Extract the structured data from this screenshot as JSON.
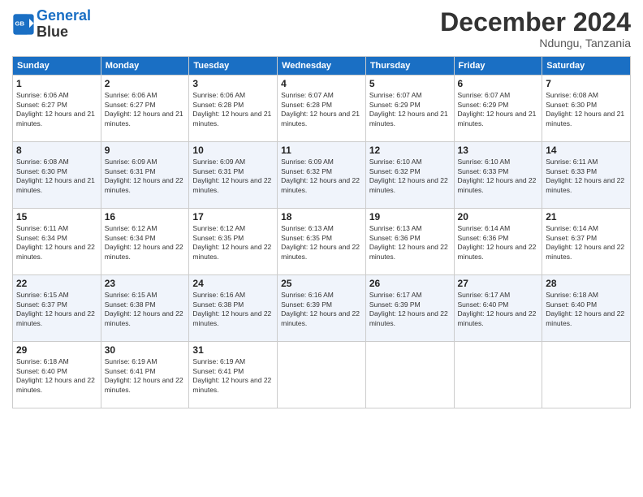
{
  "logo": {
    "line1": "General",
    "line2": "Blue"
  },
  "title": "December 2024",
  "location": "Ndungu, Tanzania",
  "days_of_week": [
    "Sunday",
    "Monday",
    "Tuesday",
    "Wednesday",
    "Thursday",
    "Friday",
    "Saturday"
  ],
  "weeks": [
    [
      {
        "day": "1",
        "sunrise": "Sunrise: 6:06 AM",
        "sunset": "Sunset: 6:27 PM",
        "daylight": "Daylight: 12 hours and 21 minutes."
      },
      {
        "day": "2",
        "sunrise": "Sunrise: 6:06 AM",
        "sunset": "Sunset: 6:27 PM",
        "daylight": "Daylight: 12 hours and 21 minutes."
      },
      {
        "day": "3",
        "sunrise": "Sunrise: 6:06 AM",
        "sunset": "Sunset: 6:28 PM",
        "daylight": "Daylight: 12 hours and 21 minutes."
      },
      {
        "day": "4",
        "sunrise": "Sunrise: 6:07 AM",
        "sunset": "Sunset: 6:28 PM",
        "daylight": "Daylight: 12 hours and 21 minutes."
      },
      {
        "day": "5",
        "sunrise": "Sunrise: 6:07 AM",
        "sunset": "Sunset: 6:29 PM",
        "daylight": "Daylight: 12 hours and 21 minutes."
      },
      {
        "day": "6",
        "sunrise": "Sunrise: 6:07 AM",
        "sunset": "Sunset: 6:29 PM",
        "daylight": "Daylight: 12 hours and 21 minutes."
      },
      {
        "day": "7",
        "sunrise": "Sunrise: 6:08 AM",
        "sunset": "Sunset: 6:30 PM",
        "daylight": "Daylight: 12 hours and 21 minutes."
      }
    ],
    [
      {
        "day": "8",
        "sunrise": "Sunrise: 6:08 AM",
        "sunset": "Sunset: 6:30 PM",
        "daylight": "Daylight: 12 hours and 21 minutes."
      },
      {
        "day": "9",
        "sunrise": "Sunrise: 6:09 AM",
        "sunset": "Sunset: 6:31 PM",
        "daylight": "Daylight: 12 hours and 22 minutes."
      },
      {
        "day": "10",
        "sunrise": "Sunrise: 6:09 AM",
        "sunset": "Sunset: 6:31 PM",
        "daylight": "Daylight: 12 hours and 22 minutes."
      },
      {
        "day": "11",
        "sunrise": "Sunrise: 6:09 AM",
        "sunset": "Sunset: 6:32 PM",
        "daylight": "Daylight: 12 hours and 22 minutes."
      },
      {
        "day": "12",
        "sunrise": "Sunrise: 6:10 AM",
        "sunset": "Sunset: 6:32 PM",
        "daylight": "Daylight: 12 hours and 22 minutes."
      },
      {
        "day": "13",
        "sunrise": "Sunrise: 6:10 AM",
        "sunset": "Sunset: 6:33 PM",
        "daylight": "Daylight: 12 hours and 22 minutes."
      },
      {
        "day": "14",
        "sunrise": "Sunrise: 6:11 AM",
        "sunset": "Sunset: 6:33 PM",
        "daylight": "Daylight: 12 hours and 22 minutes."
      }
    ],
    [
      {
        "day": "15",
        "sunrise": "Sunrise: 6:11 AM",
        "sunset": "Sunset: 6:34 PM",
        "daylight": "Daylight: 12 hours and 22 minutes."
      },
      {
        "day": "16",
        "sunrise": "Sunrise: 6:12 AM",
        "sunset": "Sunset: 6:34 PM",
        "daylight": "Daylight: 12 hours and 22 minutes."
      },
      {
        "day": "17",
        "sunrise": "Sunrise: 6:12 AM",
        "sunset": "Sunset: 6:35 PM",
        "daylight": "Daylight: 12 hours and 22 minutes."
      },
      {
        "day": "18",
        "sunrise": "Sunrise: 6:13 AM",
        "sunset": "Sunset: 6:35 PM",
        "daylight": "Daylight: 12 hours and 22 minutes."
      },
      {
        "day": "19",
        "sunrise": "Sunrise: 6:13 AM",
        "sunset": "Sunset: 6:36 PM",
        "daylight": "Daylight: 12 hours and 22 minutes."
      },
      {
        "day": "20",
        "sunrise": "Sunrise: 6:14 AM",
        "sunset": "Sunset: 6:36 PM",
        "daylight": "Daylight: 12 hours and 22 minutes."
      },
      {
        "day": "21",
        "sunrise": "Sunrise: 6:14 AM",
        "sunset": "Sunset: 6:37 PM",
        "daylight": "Daylight: 12 hours and 22 minutes."
      }
    ],
    [
      {
        "day": "22",
        "sunrise": "Sunrise: 6:15 AM",
        "sunset": "Sunset: 6:37 PM",
        "daylight": "Daylight: 12 hours and 22 minutes."
      },
      {
        "day": "23",
        "sunrise": "Sunrise: 6:15 AM",
        "sunset": "Sunset: 6:38 PM",
        "daylight": "Daylight: 12 hours and 22 minutes."
      },
      {
        "day": "24",
        "sunrise": "Sunrise: 6:16 AM",
        "sunset": "Sunset: 6:38 PM",
        "daylight": "Daylight: 12 hours and 22 minutes."
      },
      {
        "day": "25",
        "sunrise": "Sunrise: 6:16 AM",
        "sunset": "Sunset: 6:39 PM",
        "daylight": "Daylight: 12 hours and 22 minutes."
      },
      {
        "day": "26",
        "sunrise": "Sunrise: 6:17 AM",
        "sunset": "Sunset: 6:39 PM",
        "daylight": "Daylight: 12 hours and 22 minutes."
      },
      {
        "day": "27",
        "sunrise": "Sunrise: 6:17 AM",
        "sunset": "Sunset: 6:40 PM",
        "daylight": "Daylight: 12 hours and 22 minutes."
      },
      {
        "day": "28",
        "sunrise": "Sunrise: 6:18 AM",
        "sunset": "Sunset: 6:40 PM",
        "daylight": "Daylight: 12 hours and 22 minutes."
      }
    ],
    [
      {
        "day": "29",
        "sunrise": "Sunrise: 6:18 AM",
        "sunset": "Sunset: 6:40 PM",
        "daylight": "Daylight: 12 hours and 22 minutes."
      },
      {
        "day": "30",
        "sunrise": "Sunrise: 6:19 AM",
        "sunset": "Sunset: 6:41 PM",
        "daylight": "Daylight: 12 hours and 22 minutes."
      },
      {
        "day": "31",
        "sunrise": "Sunrise: 6:19 AM",
        "sunset": "Sunset: 6:41 PM",
        "daylight": "Daylight: 12 hours and 22 minutes."
      },
      null,
      null,
      null,
      null
    ]
  ]
}
